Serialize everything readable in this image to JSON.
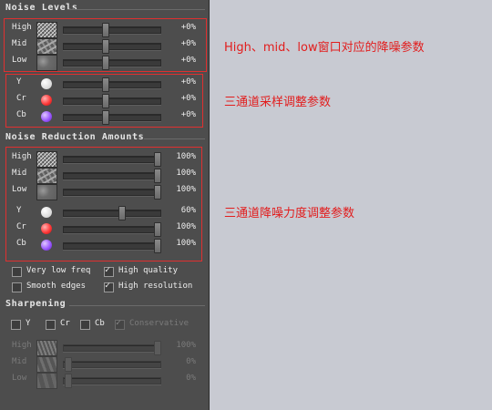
{
  "noise_levels": {
    "title": "Noise Levels",
    "rows": [
      {
        "label": "High",
        "texture": "high-noise-texture",
        "value": "+0%",
        "level": 0.42
      },
      {
        "label": "Mid",
        "texture": "mid-noise-texture",
        "value": "+0%",
        "level": 0.42
      },
      {
        "label": "Low",
        "texture": "low-noise-texture",
        "value": "+0%",
        "level": 0.42
      }
    ],
    "channels": [
      {
        "label": "Y",
        "swatch": "white-dot",
        "value": "+0%",
        "level": 0.42
      },
      {
        "label": "Cr",
        "swatch": "red-dot",
        "value": "+0%",
        "level": 0.42
      },
      {
        "label": "Cb",
        "swatch": "purple-dot",
        "value": "+0%",
        "level": 0.42
      }
    ]
  },
  "reduction": {
    "title": "Noise Reduction Amounts",
    "rows": [
      {
        "label": "High",
        "texture": "high-noise-texture",
        "value": "100%",
        "level": 1.0
      },
      {
        "label": "Mid",
        "texture": "mid-noise-texture",
        "value": "100%",
        "level": 1.0
      },
      {
        "label": "Low",
        "texture": "low-noise-texture",
        "value": "100%",
        "level": 1.0
      }
    ],
    "channels": [
      {
        "label": "Y",
        "swatch": "white-dot",
        "value": "60%",
        "level": 0.6
      },
      {
        "label": "Cr",
        "swatch": "red-dot",
        "value": "100%",
        "level": 1.0
      },
      {
        "label": "Cb",
        "swatch": "purple-dot",
        "value": "100%",
        "level": 1.0
      }
    ]
  },
  "options": [
    {
      "label": "Very low freq",
      "checked": false
    },
    {
      "label": "High quality",
      "checked": true
    },
    {
      "label": "Smooth edges",
      "checked": false
    },
    {
      "label": "High resolution",
      "checked": true
    }
  ],
  "sharpening": {
    "title": "Sharpening",
    "checks": [
      {
        "label": "Y",
        "checked": false
      },
      {
        "label": "Cr",
        "checked": false
      },
      {
        "label": "Cb",
        "checked": false
      },
      {
        "label": "Conservative",
        "checked": true,
        "disabled": true
      }
    ],
    "rows": [
      {
        "label": "High",
        "texture": "high-sharpen-texture",
        "value": "100%",
        "level": 1.0
      },
      {
        "label": "Mid",
        "texture": "mid-sharpen-texture",
        "value": "0%",
        "level": 0.0
      },
      {
        "label": "Low",
        "texture": "low-sharpen-texture",
        "value": "0%",
        "level": 0.0
      }
    ]
  },
  "annotations": {
    "levels": "High、mid、low窗口对应的降噪参数",
    "channels": "三通道采样调整参数",
    "reduction": "三通道降噪力度调整参数"
  },
  "colors": {
    "panel": "#4d4d4d",
    "annotation_red": "#e21d1d",
    "right_background": "#c8cad2"
  }
}
